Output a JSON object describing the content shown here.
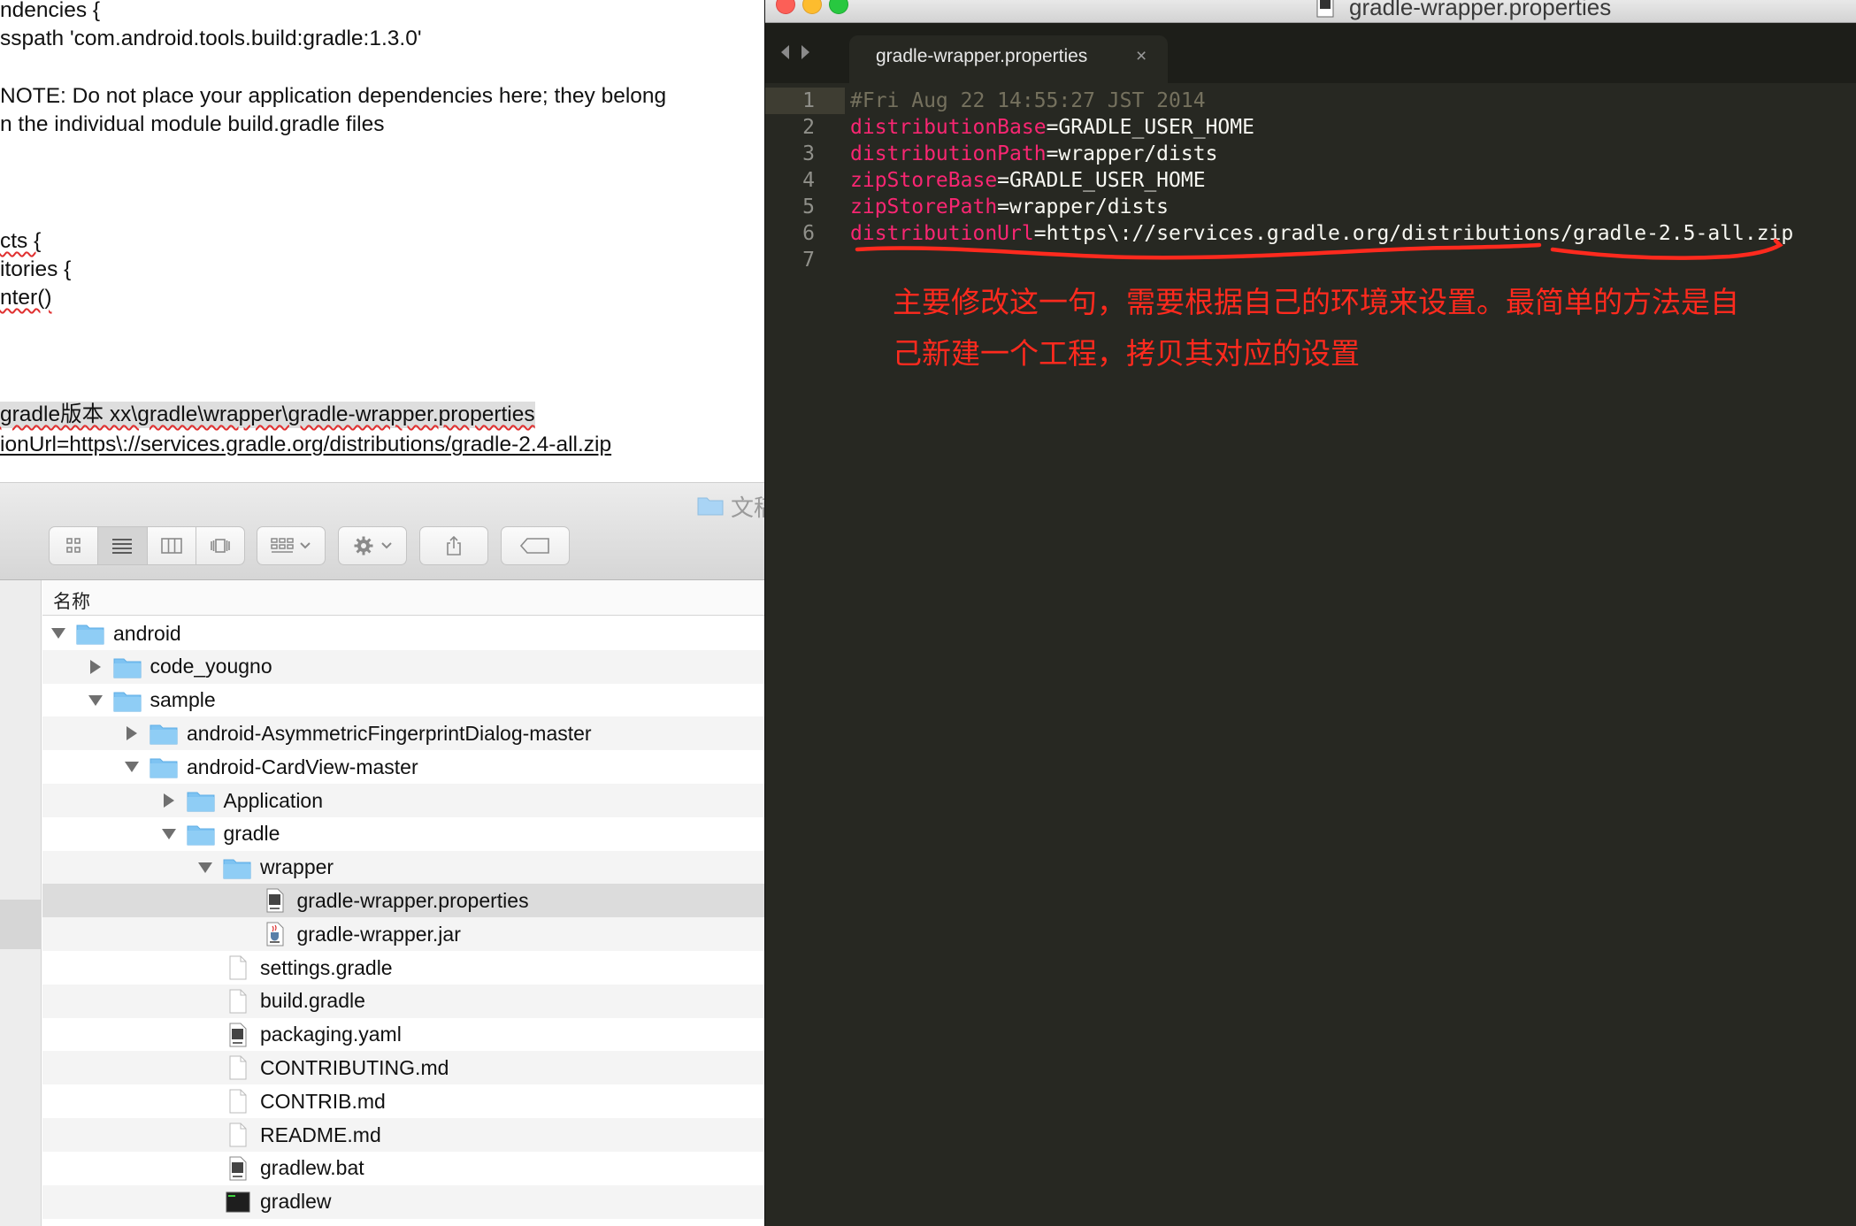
{
  "document": {
    "lines": [
      "ndencies {",
      "sspath 'com.android.tools.build:gradle:1.3.0'",
      "NOTE: Do not place your application dependencies here; they belong",
      "n the individual module build.gradle files",
      "cts {",
      "itories {",
      "nter()",
      "gradle版本  xx\\gradle\\wrapper\\gradle-wrapper.properties",
      "ionUrl=https\\://services.gradle.org/distributions/gradle-2.4-all.zip"
    ]
  },
  "finder": {
    "title": "文稿",
    "column_header": "名称",
    "rows": [
      {
        "name": "android",
        "level": 0,
        "type": "folder",
        "expanded": true
      },
      {
        "name": "code_yougno",
        "level": 1,
        "type": "folder",
        "expanded": false
      },
      {
        "name": "sample",
        "level": 1,
        "type": "folder",
        "expanded": true
      },
      {
        "name": "android-AsymmetricFingerprintDialog-master",
        "level": 2,
        "type": "folder",
        "expanded": false
      },
      {
        "name": "android-CardView-master",
        "level": 2,
        "type": "folder",
        "expanded": true
      },
      {
        "name": "Application",
        "level": 3,
        "type": "folder",
        "expanded": false
      },
      {
        "name": "gradle",
        "level": 3,
        "type": "folder",
        "expanded": true
      },
      {
        "name": "wrapper",
        "level": 4,
        "type": "folder",
        "expanded": true
      },
      {
        "name": "gradle-wrapper.properties",
        "level": 5,
        "type": "doc-file",
        "selected": true
      },
      {
        "name": "gradle-wrapper.jar",
        "level": 5,
        "type": "jar-file"
      },
      {
        "name": "settings.gradle",
        "level": 4,
        "type": "file"
      },
      {
        "name": "build.gradle",
        "level": 4,
        "type": "file"
      },
      {
        "name": "packaging.yaml",
        "level": 4,
        "type": "doc-file"
      },
      {
        "name": "CONTRIBUTING.md",
        "level": 4,
        "type": "file"
      },
      {
        "name": "CONTRIB.md",
        "level": 4,
        "type": "file"
      },
      {
        "name": "README.md",
        "level": 4,
        "type": "file"
      },
      {
        "name": "gradlew.bat",
        "level": 4,
        "type": "doc-file"
      },
      {
        "name": "gradlew",
        "level": 4,
        "type": "exec-file"
      }
    ]
  },
  "editor": {
    "window_title": "gradle-wrapper.properties",
    "tab_label": "gradle-wrapper.properties",
    "tab_close": "×",
    "current_line": 1,
    "line_numbers": [
      "1",
      "2",
      "3",
      "4",
      "5",
      "6",
      "7"
    ],
    "code": {
      "comment": "#Fri Aug 22 14:55:27 JST 2014",
      "lines": [
        {
          "key": "distributionBase",
          "value": "=GRADLE_USER_HOME"
        },
        {
          "key": "distributionPath",
          "value": "=wrapper/dists"
        },
        {
          "key": "zipStoreBase",
          "value": "=GRADLE_USER_HOME"
        },
        {
          "key": "zipStorePath",
          "value": "=wrapper/dists"
        },
        {
          "key": "distributionUrl",
          "value": "=https\\://services.gradle.org/distributions/gradle-2.5-all.zip"
        }
      ]
    },
    "annotation": {
      "line1": "主要修改这一句，需要根据自己的环境来设置。最简单的方法是自",
      "line2": "己新建一个工程，拷贝其对应的设置",
      "color": "#ff2a1e"
    }
  },
  "colors": {
    "editor_bg": "#272822",
    "keyword": "#f92672",
    "comment": "#75715e",
    "folder_blue": "#7ec3f2"
  }
}
